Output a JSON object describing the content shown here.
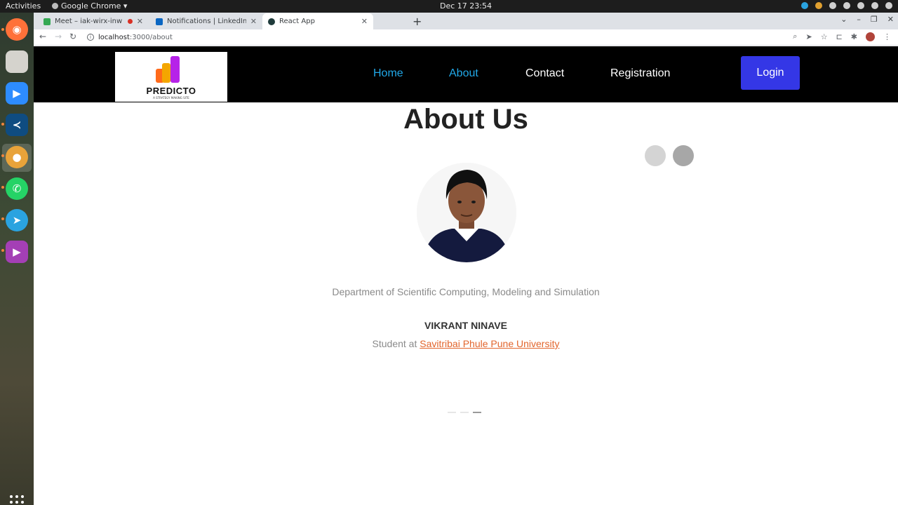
{
  "system": {
    "activities": "Activities",
    "app_menu": "Google Chrome ▾",
    "clock": "Dec 17  23:54"
  },
  "browser": {
    "tabs": [
      {
        "title": "Meet – iak-wirx-inw",
        "favicon_color": "#34a853"
      },
      {
        "title": "Notifications | LinkedIn",
        "favicon_color": "#0a66c2"
      },
      {
        "title": "React App",
        "favicon_color": "#1f3b3b"
      }
    ],
    "url_host": "localhost",
    "url_path": ":3000/about"
  },
  "navbar": {
    "logo_title": "PREDICTO",
    "logo_tagline": "A STRATEGY MAKING SITE",
    "links": [
      "Home",
      "About",
      "Contact",
      "Registration"
    ],
    "login": "Login"
  },
  "about": {
    "title": "About Us",
    "department": "Department of Scientific Computing, Modeling and Simulation",
    "name": "VIKRANT NINAVE",
    "role_prefix": "Student at ",
    "university": "Savitribai Phule Pune University"
  },
  "colors": {
    "navbar_bg": "#000000",
    "nav_active": "#21a8e8",
    "login_bg": "#3437e6",
    "link_orange": "#e2652c"
  }
}
